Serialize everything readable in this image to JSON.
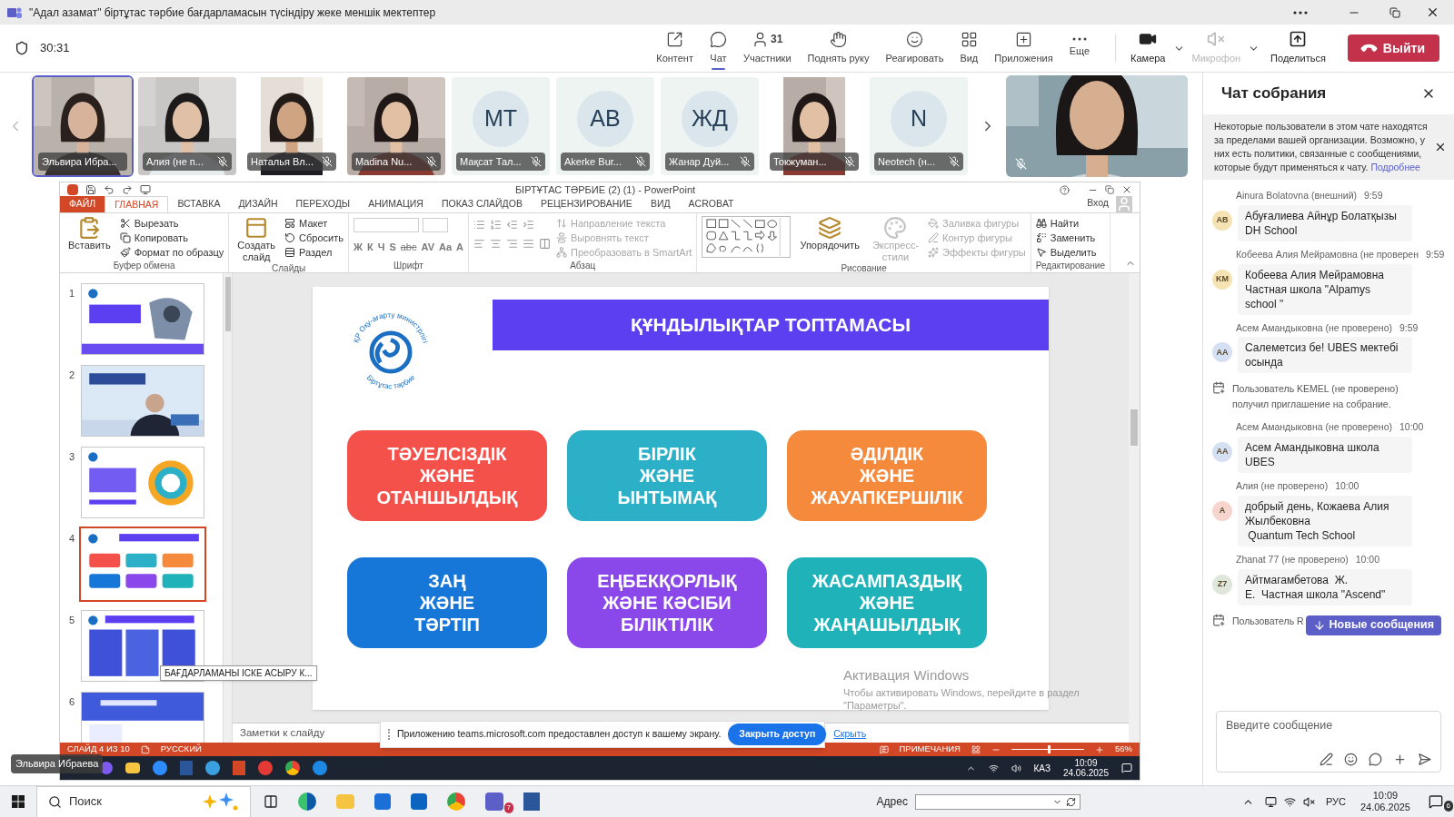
{
  "window": {
    "title": "\"Адал азамат\" біртұтас тәрбие бағдарламасын түсіндіру жеке меншік мектептер"
  },
  "meeting": {
    "timer": "30:31"
  },
  "toolbar": [
    {
      "label": "Контент",
      "selected": false,
      "disabled": false
    },
    {
      "label": "Чат",
      "selected": true,
      "disabled": false
    },
    {
      "label": "Участники",
      "count": "31",
      "selected": false,
      "disabled": false
    },
    {
      "label": "Поднять руку",
      "selected": false,
      "disabled": false
    },
    {
      "label": "Реагировать",
      "selected": false,
      "disabled": false
    },
    {
      "label": "Вид",
      "selected": false,
      "disabled": false
    },
    {
      "label": "Приложения",
      "selected": false,
      "disabled": false
    },
    {
      "label": "Еще",
      "selected": false,
      "disabled": false
    }
  ],
  "devices": [
    {
      "label": "Камера",
      "disabled": false
    },
    {
      "label": "Микрофон",
      "disabled": true
    }
  ],
  "share": {
    "label": "Поделиться"
  },
  "leave_button": "Выйти",
  "participants": [
    {
      "kind": "video",
      "name": "Эльвира Ибра...",
      "muted": false,
      "selected": true
    },
    {
      "kind": "video",
      "name": "Алия (не п...",
      "muted": true,
      "selected": false
    },
    {
      "kind": "portrait",
      "name": "Наталья Вл...",
      "muted": true,
      "selected": false
    },
    {
      "kind": "video",
      "name": "Madina Nu...",
      "muted": true,
      "selected": false
    },
    {
      "kind": "initials",
      "initials": "МТ",
      "name": "Мақсат Тал...",
      "muted": true,
      "selected": false
    },
    {
      "kind": "initials",
      "initials": "AB",
      "name": "Akerke Bur...",
      "muted": true,
      "selected": false
    },
    {
      "kind": "initials",
      "initials": "ЖД",
      "name": "Жанар Дуй...",
      "muted": true,
      "selected": false
    },
    {
      "kind": "portrait",
      "name": "Токжуман...",
      "muted": true,
      "selected": false
    },
    {
      "kind": "initials",
      "initials": "N",
      "name": "Neotech (н...",
      "muted": true,
      "selected": false
    }
  ],
  "self_tile": {
    "muted": true
  },
  "ppt": {
    "title": "БІРТҰТАС ТӘРБИЕ (2) (1) - PowerPoint",
    "sign_in": "Вход",
    "tabs": [
      {
        "label": "ФАЙЛ",
        "kind": "file",
        "selected": false
      },
      {
        "label": "ГЛАВНАЯ",
        "kind": "tab",
        "selected": true
      },
      {
        "label": "ВСТАВКА",
        "kind": "tab",
        "selected": false
      },
      {
        "label": "ДИЗАЙН",
        "kind": "tab",
        "selected": false
      },
      {
        "label": "ПЕРЕХОДЫ",
        "kind": "tab",
        "selected": false
      },
      {
        "label": "АНИМАЦИЯ",
        "kind": "tab",
        "selected": false
      },
      {
        "label": "ПОКАЗ СЛАЙДОВ",
        "kind": "tab",
        "selected": false
      },
      {
        "label": "РЕЦЕНЗИРОВАНИЕ",
        "kind": "tab",
        "selected": false
      },
      {
        "label": "ВИД",
        "kind": "tab",
        "selected": false
      },
      {
        "label": "ACROBAT",
        "kind": "tab",
        "selected": false
      }
    ],
    "ribbon": [
      {
        "label": "Буфер обмена",
        "columns": [
          [
            {
              "kind": "big",
              "label": "Вставить",
              "disabled": false
            }
          ],
          [
            {
              "kind": "small",
              "label": "Вырезать",
              "disabled": false
            },
            {
              "kind": "small",
              "label": "Копировать",
              "disabled": false
            },
            {
              "kind": "small",
              "label": "Формат по образцу",
              "disabled": false
            }
          ]
        ]
      },
      {
        "label": "Слайды",
        "columns": [
          [
            {
              "kind": "big",
              "label": "Создать\nслайд",
              "disabled": false
            }
          ],
          [
            {
              "kind": "small",
              "label": "Макет",
              "disabled": false
            },
            {
              "kind": "small",
              "label": "Сбросить",
              "disabled": false
            },
            {
              "kind": "small",
              "label": "Раздел",
              "disabled": false
            }
          ]
        ]
      },
      {
        "label": "Шрифт",
        "columns": [
          [
            {
              "kind": "font_fields"
            },
            {
              "kind": "glyphs",
              "labels": [
                "Ж",
                "К",
                "Ч",
                "S",
                "abc",
                "AV",
                "Aa",
                "A"
              ]
            }
          ]
        ]
      },
      {
        "label": "Абзац",
        "columns": [
          [
            {
              "kind": "list_icons"
            },
            {
              "kind": "align_icons"
            }
          ],
          [
            {
              "kind": "small",
              "label": "Направление текста",
              "disabled": true
            },
            {
              "kind": "small",
              "label": "Выровнять текст",
              "disabled": true
            },
            {
              "kind": "small",
              "label": "Преобразовать в SmartArt",
              "disabled": true
            }
          ]
        ]
      },
      {
        "label": "Рисование",
        "columns": [
          [
            {
              "kind": "gallery"
            }
          ],
          [
            {
              "kind": "big",
              "label": "Упорядочить",
              "disabled": false
            }
          ],
          [
            {
              "kind": "big",
              "label": "Экспресс-\nстили",
              "disabled": true
            }
          ],
          [
            {
              "kind": "small",
              "label": "Заливка фигуры",
              "disabled": true
            },
            {
              "kind": "small",
              "label": "Контур фигуры",
              "disabled": true
            },
            {
              "kind": "small",
              "label": "Эффекты фигуры",
              "disabled": true
            }
          ]
        ]
      },
      {
        "label": "Редактирование",
        "columns": [
          [
            {
              "kind": "small",
              "label": "Найти",
              "disabled": false
            },
            {
              "kind": "small",
              "label": "Заменить",
              "disabled": false
            },
            {
              "kind": "small",
              "label": "Выделить",
              "disabled": false
            }
          ]
        ]
      }
    ],
    "thumbnails": [
      {
        "number": "1",
        "selected": false
      },
      {
        "number": "2",
        "selected": false
      },
      {
        "number": "3",
        "selected": false
      },
      {
        "number": "4",
        "selected": true
      },
      {
        "number": "5",
        "selected": false
      },
      {
        "number": "6",
        "selected": false
      }
    ],
    "tooltip": "БАҒДАРЛАМАНЫ ІСКЕ АСЫРУ К...",
    "slide": {
      "logo": {
        "top_text": "ҚР Оқу-ағарту министрлігі",
        "bottom_text": "Біртұтас тәрбие"
      },
      "title": "ҚҰНДЫЛЫҚТАР ТОПТАМАСЫ",
      "cards": [
        {
          "text": "ТӘУЕЛСІЗДІК\nЖӘНЕ\nОТАНШЫЛДЫҚ",
          "color": "#f4514b"
        },
        {
          "text": "БІРЛІК\nЖӘНЕ\nЫНТЫМАҚ",
          "color": "#2bb0c8"
        },
        {
          "text": "ӘДІЛДІК\nЖӘНЕ\nЖАУАПКЕРШІЛІК",
          "color": "#f58a3c"
        },
        {
          "text": "ЗАҢ\nЖӘНЕ\nТӘРТІП",
          "color": "#1677d8"
        },
        {
          "text": "ЕҢБЕКҚОРЛЫҚ\nЖӘНЕ КӘСІБИ\nБІЛІКТІЛІК",
          "color": "#8a47ea"
        },
        {
          "text": "ЖАСАМПАЗДЫҚ\nЖӘНЕ\nЖАҢАШЫЛДЫҚ",
          "color": "#1fb2b8"
        }
      ]
    },
    "notes": "Заметки к слайду",
    "watermark": {
      "title": "Активация Windows",
      "text": "Чтобы активировать Windows, перейдите в раздел\n\"Параметры\"."
    },
    "status_bar": {
      "slide": "СЛАЙД 4 ИЗ 10",
      "language": "РУССКИЙ",
      "comments": "ПРИМЕЧАНИЯ",
      "zoom": {
        "level": 0.5,
        "reading": "56%"
      }
    },
    "taskbar": {
      "language": "КАЗ",
      "time": "10:09",
      "date": "24.06.2025"
    },
    "presenter": "Эльвира Ибраева"
  },
  "share_notice": {
    "text": "Приложению teams.microsoft.com предоставлен доступ к вашему экрану.",
    "stop": "Закрыть доступ",
    "hide": "Скрыть"
  },
  "chat": {
    "title": "Чат собрания",
    "notice": "Некоторые пользователи в этом чате находятся за пределами вашей организации. Возможно, у них есть политики, связанные с сообщениями, которые будут применяться к чату.",
    "notice_link": "Подробнее",
    "messages": [
      {
        "kind": "message",
        "sender": "Ainura Bolatovna (внешний)",
        "time": "9:59",
        "initials": "AB",
        "color": "#f5e3b3",
        "text": "Абуғалиева Айнұр Болатқызы\nDH School"
      },
      {
        "kind": "message",
        "sender": "Кобеева Алия Мейрамовна (не проверен",
        "time": "9:59",
        "initials": "KM",
        "color": "#f5e3b3",
        "text": "Кобеева Алия Мейрамовна\nЧастная школа \"Alpamys\nschool \""
      },
      {
        "kind": "message",
        "sender": "Асем Амандыковна (не проверено)",
        "time": "9:59",
        "initials": "AA",
        "color": "#d5e0f3",
        "text": "Салеметсиз бе! UBES мектебі\nосында"
      },
      {
        "kind": "event",
        "text": "Пользователь KEMEL (не проверено)\nполучил приглашение на собрание."
      },
      {
        "kind": "message",
        "sender": "Асем Амандыковна (не проверено)",
        "time": "10:00",
        "initials": "AA",
        "color": "#d5e0f3",
        "text": "Асем Амандыковна школа\nUBES"
      },
      {
        "kind": "message",
        "sender": "Алия (не проверено)",
        "time": "10:00",
        "initials": "A",
        "color": "#f6d5cf",
        "text": "добрый день, Кожаева Алия\nЖылбековна\n Quantum Tech School"
      },
      {
        "kind": "message",
        "sender": "Zhanat 77 (не проверено)",
        "time": "10:00",
        "initials": "Z7",
        "color": "#dfe6dc",
        "text": "Айтмагамбетова  Ж.\nЕ.  Частная школа \"Ascend\""
      },
      {
        "kind": "event",
        "text": "Пользователь R"
      }
    ],
    "new_messages": "Новые сообщения",
    "placeholder": "Введите сообщение"
  },
  "taskbar": {
    "search": "Поиск",
    "teams_badge": "7",
    "address_label": "Адрес",
    "language": "РУС",
    "time": "10:09",
    "date": "24.06.2025",
    "notifications": "6"
  }
}
